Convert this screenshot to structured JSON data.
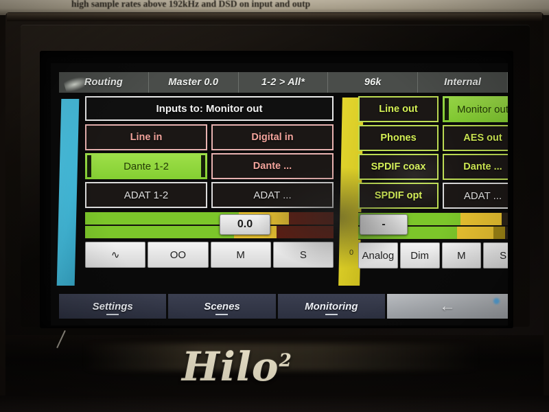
{
  "background_note": {
    "paper_text": "high sample rates above 192kHz and DSD on input and outp"
  },
  "device": {
    "brand": "Hilo",
    "brand_superscript": "2"
  },
  "status_bar": {
    "cells": [
      {
        "name": "page",
        "label": "Routing"
      },
      {
        "name": "master",
        "label": "Master 0.0"
      },
      {
        "name": "source-dest",
        "label": "1-2 > All*"
      },
      {
        "name": "sample-rate",
        "label": "96k"
      },
      {
        "name": "clock-source",
        "label": "Internal"
      }
    ]
  },
  "left_panel": {
    "header": "Inputs to: Monitor out",
    "buttons": [
      {
        "label": "Line in",
        "style": "pink",
        "selected": false
      },
      {
        "label": "Digital in",
        "style": "pink",
        "selected": false
      },
      {
        "label": "Dante 1-2",
        "style": "pink",
        "selected": true
      },
      {
        "label": "Dante ...",
        "style": "pink",
        "selected": false
      },
      {
        "label": "ADAT 1-2",
        "style": "white",
        "selected": false
      },
      {
        "label": "ADAT ...",
        "style": "white",
        "selected": false
      }
    ],
    "meter": {
      "value": "0.0",
      "green_pct": 62,
      "yellow_pct": 20,
      "red_pct": 18
    },
    "function_buttons": [
      {
        "name": "sine-wave-icon",
        "label": "∿"
      },
      {
        "name": "link-channels-icon",
        "label": "OO"
      },
      {
        "name": "mute-button",
        "label": "M"
      },
      {
        "name": "solo-button",
        "label": "S"
      }
    ]
  },
  "right_panel": {
    "buttons": [
      {
        "label": "Line out",
        "style": "lime",
        "selected": false
      },
      {
        "label": "Monitor out",
        "style": "lime",
        "selected": true
      },
      {
        "label": "Phones",
        "style": "lime",
        "selected": false
      },
      {
        "label": "AES out",
        "style": "lime",
        "selected": false
      },
      {
        "label": "SPDIF coax",
        "style": "lime",
        "selected": false
      },
      {
        "label": "Dante ...",
        "style": "lime",
        "selected": false
      },
      {
        "label": "SPDIF opt",
        "style": "lime",
        "selected": false
      },
      {
        "label": "ADAT ...",
        "style": "limew",
        "selected": false
      }
    ],
    "meter": {
      "value": "-",
      "green_pct": 62,
      "yellow_pct": 25,
      "red_pct": 13
    },
    "function_buttons": [
      {
        "name": "analog-button",
        "label": "Analog"
      },
      {
        "name": "dim-button",
        "label": "Dim"
      },
      {
        "name": "mute-button",
        "label": "M"
      },
      {
        "name": "solo-button",
        "label": "S"
      }
    ]
  },
  "bus_strips": {
    "input_strip_color": "#43bcdd",
    "output_strip_color": "#d9cb26",
    "output_strip_label": "0"
  },
  "nav_bar": {
    "items": [
      {
        "label": "Settings",
        "name": "nav-settings"
      },
      {
        "label": "Scenes",
        "name": "nav-scenes"
      },
      {
        "label": "Monitoring",
        "name": "nav-monitoring"
      }
    ],
    "back": {
      "name": "nav-back",
      "glyph": "←"
    }
  },
  "colors": {
    "selected_green": "#8fd13c",
    "input_pink": "#f3a49c",
    "output_lime": "#d4ef55",
    "meter_green": "#7cc62a",
    "meter_yellow": "#e8c130",
    "meter_red": "#e0563a"
  }
}
